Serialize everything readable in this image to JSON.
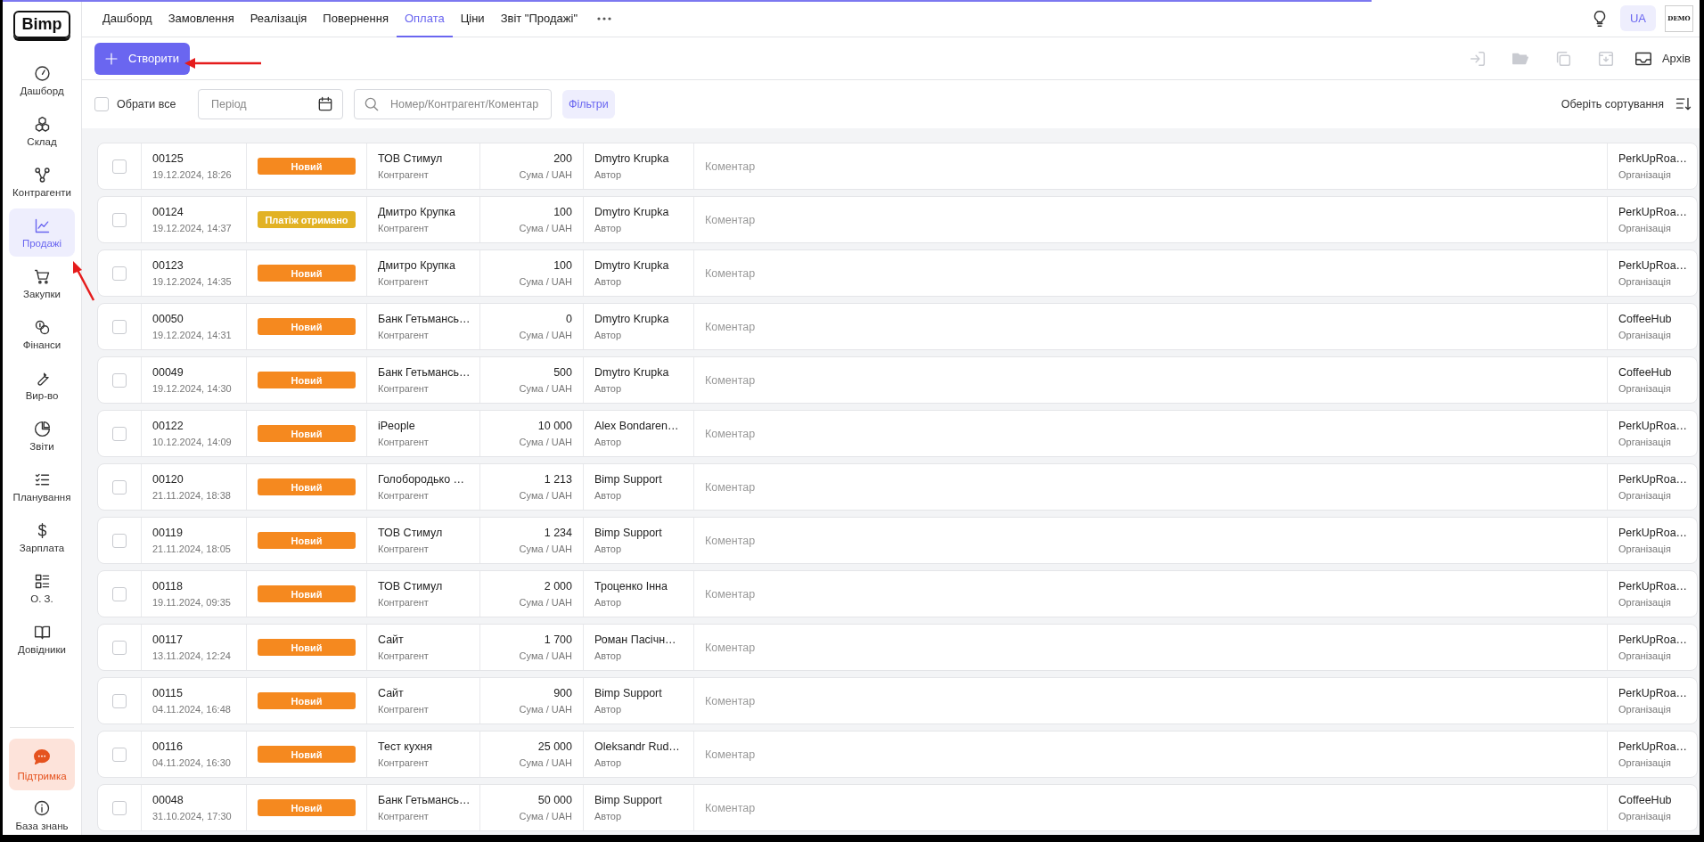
{
  "loading_bar": {
    "level": 0.845
  },
  "sidebar": {
    "logo": "Bimp",
    "items": [
      {
        "label": "Дашборд",
        "selected": false
      },
      {
        "label": "Склад",
        "selected": false
      },
      {
        "label": "Контрагенти",
        "selected": false
      },
      {
        "label": "Продажі",
        "selected": true
      },
      {
        "label": "Закупки",
        "selected": false
      },
      {
        "label": "Фінанси",
        "selected": false
      },
      {
        "label": "Вир-во",
        "selected": false
      },
      {
        "label": "Звіти",
        "selected": false
      },
      {
        "label": "Планування",
        "selected": false
      },
      {
        "label": "Зарплата",
        "selected": false
      },
      {
        "label": "О. З.",
        "selected": false
      },
      {
        "label": "Довідники",
        "selected": false
      }
    ],
    "support": "Підтримка",
    "knowledge_base": "База знань"
  },
  "tabs": [
    {
      "label": "Дашборд",
      "selected": false
    },
    {
      "label": "Замовлення",
      "selected": false
    },
    {
      "label": "Реалізація",
      "selected": false
    },
    {
      "label": "Повернення",
      "selected": false
    },
    {
      "label": "Оплата",
      "selected": true
    },
    {
      "label": "Ціни",
      "selected": false
    },
    {
      "label": "Звіт \"Продажі\"",
      "selected": false
    }
  ],
  "header": {
    "language": "UA",
    "avatar": "DEMO"
  },
  "toolbar": {
    "create": "Створити",
    "actions": [
      {
        "disabled": true
      },
      {
        "disabled": true
      },
      {
        "disabled": true
      },
      {
        "disabled": true
      }
    ],
    "archive": "Архів"
  },
  "filters": {
    "select_all": {
      "label": "Обрати все",
      "checked": false
    },
    "period": {
      "placeholder": "Період"
    },
    "search": {
      "placeholder": "Номер/Контрагент/Коментар"
    },
    "filters_button": "Фільтри",
    "sort": "Оберіть сортування"
  },
  "rows": [
    {
      "checked": false,
      "number": "00125",
      "date": "19.12.2024, 18:26",
      "status": {
        "label": "Новий",
        "color": "#f5891f"
      },
      "contractor": "ТОВ Стимул",
      "contractor_label": "Контрагент",
      "amount": "200",
      "amount_label": "Сума / UAH",
      "author": "Dmytro Krupka",
      "author_label": "Автор",
      "comment": "Коментар",
      "organization": "PerkUpRoa…",
      "organization_label": "Організація"
    },
    {
      "checked": false,
      "number": "00124",
      "date": "19.12.2024, 14:37",
      "status": {
        "label": "Платіж отримано",
        "color": "#e2b224"
      },
      "contractor": "Дмитро Крупка",
      "contractor_label": "Контрагент",
      "amount": "100",
      "amount_label": "Сума / UAH",
      "author": "Dmytro Krupka",
      "author_label": "Автор",
      "comment": "Коментар",
      "organization": "PerkUpRoa…",
      "organization_label": "Організація"
    },
    {
      "checked": false,
      "number": "00123",
      "date": "19.12.2024, 14:35",
      "status": {
        "label": "Новий",
        "color": "#f5891f"
      },
      "contractor": "Дмитро Крупка",
      "contractor_label": "Контрагент",
      "amount": "100",
      "amount_label": "Сума / UAH",
      "author": "Dmytro Krupka",
      "author_label": "Автор",
      "comment": "Коментар",
      "organization": "PerkUpRoa…",
      "organization_label": "Організація"
    },
    {
      "checked": false,
      "number": "00050",
      "date": "19.12.2024, 14:31",
      "status": {
        "label": "Новий",
        "color": "#f5891f"
      },
      "contractor": "Банк Гетьмансь…",
      "contractor_label": "Контрагент",
      "amount": "0",
      "amount_label": "Сума / UAH",
      "author": "Dmytro Krupka",
      "author_label": "Автор",
      "comment": "Коментар",
      "organization": "CoffeeHub",
      "organization_label": "Організація"
    },
    {
      "checked": false,
      "number": "00049",
      "date": "19.12.2024, 14:30",
      "status": {
        "label": "Новий",
        "color": "#f5891f"
      },
      "contractor": "Банк Гетьмансь…",
      "contractor_label": "Контрагент",
      "amount": "500",
      "amount_label": "Сума / UAH",
      "author": "Dmytro Krupka",
      "author_label": "Автор",
      "comment": "Коментар",
      "organization": "CoffeeHub",
      "organization_label": "Організація"
    },
    {
      "checked": false,
      "number": "00122",
      "date": "10.12.2024, 14:09",
      "status": {
        "label": "Новий",
        "color": "#f5891f"
      },
      "contractor": "iPeople",
      "contractor_label": "Контрагент",
      "amount": "10 000",
      "amount_label": "Сума / UAH",
      "author": "Alex Bondaren…",
      "author_label": "Автор",
      "comment": "Коментар",
      "organization": "PerkUpRoa…",
      "organization_label": "Організація"
    },
    {
      "checked": false,
      "number": "00120",
      "date": "21.11.2024, 18:38",
      "status": {
        "label": "Новий",
        "color": "#f5891f"
      },
      "contractor": "Голобородько …",
      "contractor_label": "Контрагент",
      "amount": "1 213",
      "amount_label": "Сума / UAH",
      "author": "Bimp Support",
      "author_label": "Автор",
      "comment": "Коментар",
      "organization": "PerkUpRoa…",
      "organization_label": "Організація"
    },
    {
      "checked": false,
      "number": "00119",
      "date": "21.11.2024, 18:05",
      "status": {
        "label": "Новий",
        "color": "#f5891f"
      },
      "contractor": "ТОВ Стимул",
      "contractor_label": "Контрагент",
      "amount": "1 234",
      "amount_label": "Сума / UAH",
      "author": "Bimp Support",
      "author_label": "Автор",
      "comment": "Коментар",
      "organization": "PerkUpRoa…",
      "organization_label": "Організація"
    },
    {
      "checked": false,
      "number": "00118",
      "date": "19.11.2024, 09:35",
      "status": {
        "label": "Новий",
        "color": "#f5891f"
      },
      "contractor": "ТОВ Стимул",
      "contractor_label": "Контрагент",
      "amount": "2 000",
      "amount_label": "Сума / UAH",
      "author": "Троценко Інна",
      "author_label": "Автор",
      "comment": "Коментар",
      "organization": "PerkUpRoa…",
      "organization_label": "Організація"
    },
    {
      "checked": false,
      "number": "00117",
      "date": "13.11.2024, 12:24",
      "status": {
        "label": "Новий",
        "color": "#f5891f"
      },
      "contractor": "Сайт",
      "contractor_label": "Контрагент",
      "amount": "1 700",
      "amount_label": "Сума / UAH",
      "author": "Роман Пасічн…",
      "author_label": "Автор",
      "comment": "Коментар",
      "organization": "PerkUpRoa…",
      "organization_label": "Організація"
    },
    {
      "checked": false,
      "number": "00115",
      "date": "04.11.2024, 16:48",
      "status": {
        "label": "Новий",
        "color": "#f5891f"
      },
      "contractor": "Сайт",
      "contractor_label": "Контрагент",
      "amount": "900",
      "amount_label": "Сума / UAH",
      "author": "Bimp Support",
      "author_label": "Автор",
      "comment": "Коментар",
      "organization": "PerkUpRoa…",
      "organization_label": "Організація"
    },
    {
      "checked": false,
      "number": "00116",
      "date": "04.11.2024, 16:30",
      "status": {
        "label": "Новий",
        "color": "#f5891f"
      },
      "contractor": "Тест кухня",
      "contractor_label": "Контрагент",
      "amount": "25 000",
      "amount_label": "Сума / UAH",
      "author": "Oleksandr Rud…",
      "author_label": "Автор",
      "comment": "Коментар",
      "organization": "PerkUpRoa…",
      "organization_label": "Організація"
    },
    {
      "checked": false,
      "number": "00048",
      "date": "31.10.2024, 17:30",
      "status": {
        "label": "Новий",
        "color": "#f5891f"
      },
      "contractor": "Банк Гетьмансь…",
      "contractor_label": "Контрагент",
      "amount": "50 000",
      "amount_label": "Сума / UAH",
      "author": "Bimp Support",
      "author_label": "Автор",
      "comment": "Коментар",
      "organization": "CoffeeHub",
      "organization_label": "Організація"
    }
  ]
}
